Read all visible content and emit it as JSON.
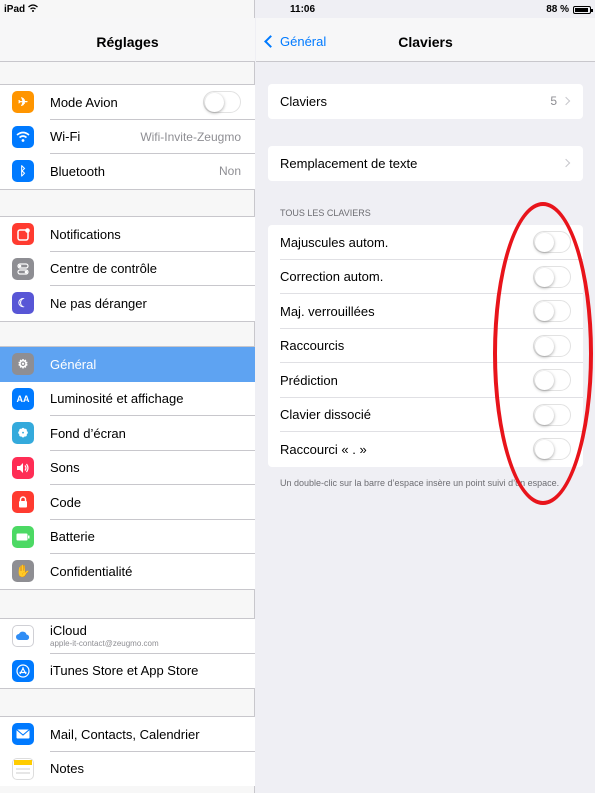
{
  "status": {
    "device": "iPad",
    "time": "11:06",
    "battery": "88 %"
  },
  "left": {
    "title": "Réglages",
    "group1": [
      {
        "icon": "airplane-icon",
        "label": "Mode Avion",
        "toggle": false,
        "color": "#ff9500"
      },
      {
        "icon": "wifi-icon",
        "label": "Wi-Fi",
        "value": "Wifi-Invite-Zeugmo",
        "color": "#007aff"
      },
      {
        "icon": "bluetooth-icon",
        "label": "Bluetooth",
        "value": "Non",
        "color": "#007aff"
      }
    ],
    "group2": [
      {
        "icon": "notifications-icon",
        "label": "Notifications",
        "color": "#ff3b30"
      },
      {
        "icon": "control-center-icon",
        "label": "Centre de contrôle",
        "color": "#8e8e93"
      },
      {
        "icon": "moon-icon",
        "label": "Ne pas déranger",
        "color": "#5856d6"
      }
    ],
    "group3": [
      {
        "icon": "gear-icon",
        "label": "Général",
        "selected": true,
        "color": "#8e8e93"
      },
      {
        "icon": "brightness-icon",
        "label": "Luminosité et affichage",
        "color": "#007aff"
      },
      {
        "icon": "wallpaper-icon",
        "label": "Fond d’écran",
        "color": "#34aadc"
      },
      {
        "icon": "sound-icon",
        "label": "Sons",
        "color": "#ff2d55"
      },
      {
        "icon": "lock-icon",
        "label": "Code",
        "color": "#ff3b30"
      },
      {
        "icon": "battery-icon",
        "label": "Batterie",
        "color": "#4cd964"
      },
      {
        "icon": "hand-icon",
        "label": "Confidentialité",
        "color": "#8e8e93"
      }
    ],
    "group4": [
      {
        "icon": "icloud-icon",
        "label": "iCloud",
        "sub": "apple-it-contact@zeugmo.com",
        "color": "#ffffff"
      },
      {
        "icon": "appstore-icon",
        "label": "iTunes Store et App Store",
        "color": "#007aff"
      }
    ],
    "group5": [
      {
        "icon": "mail-icon",
        "label": "Mail, Contacts, Calendrier",
        "color": "#007aff"
      },
      {
        "icon": "notes-icon",
        "label": "Notes",
        "color": "#ffcc00"
      }
    ]
  },
  "right": {
    "back": "Général",
    "title": "Claviers",
    "claviers_label": "Claviers",
    "claviers_count": "5",
    "replacement_label": "Remplacement de texte",
    "section_header": "TOUS LES CLAVIERS",
    "toggles": [
      {
        "label": "Majuscules autom.",
        "on": false
      },
      {
        "label": "Correction autom.",
        "on": false
      },
      {
        "label": "Maj. verrouillées",
        "on": false
      },
      {
        "label": "Raccourcis",
        "on": false
      },
      {
        "label": "Prédiction",
        "on": false
      },
      {
        "label": "Clavier dissocié",
        "on": false
      },
      {
        "label": "Raccourci « . »",
        "on": false
      }
    ],
    "footer": "Un double-clic sur la barre d’espace insère un point suivi d’un espace."
  },
  "annotation": {
    "color": "#e8141b"
  }
}
